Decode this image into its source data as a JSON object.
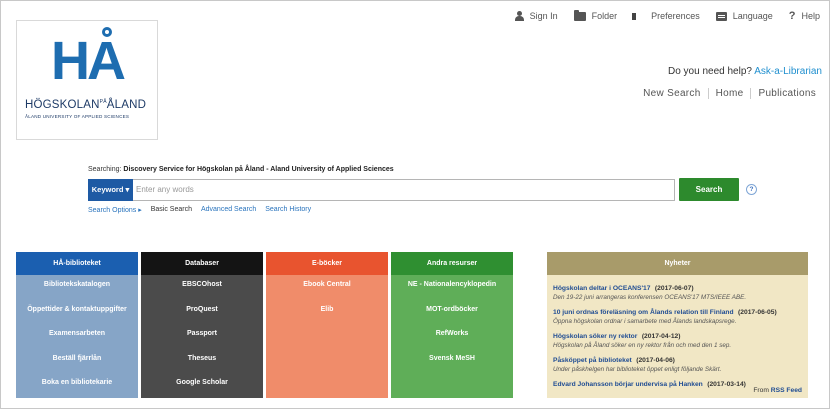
{
  "toolbar": {
    "sign_in": "Sign In",
    "folder": "Folder",
    "preferences": "Preferences",
    "language": "Language",
    "help": "Help",
    "help_glyph": "?"
  },
  "logo": {
    "mark": "HA",
    "name": "HÖGSKOLAN",
    "name_small": "PÅ",
    "name_end": "ÅLAND",
    "subtitle": "ÅLAND UNIVERSITY OF APPLIED SCIENCES"
  },
  "help_prompt": {
    "text": "Do you need help?",
    "link": "Ask-a-Librarian"
  },
  "nav": [
    "New Search",
    "Home",
    "Publications"
  ],
  "search": {
    "searching_label": "Searching:",
    "searching_source": "Discovery Service for Högskolan på Åland - Aland University of Applied Sciences",
    "mode": "Keyword ▾",
    "placeholder": "Enter any words",
    "button": "Search",
    "help_glyph": "?",
    "options": "Search Options ▸",
    "basic": "Basic Search",
    "advanced": "Advanced Search",
    "history": "Search History"
  },
  "panels": [
    {
      "title": "HÅ-biblioteket",
      "color": "#1b5fb0",
      "items": [
        "Bibliotekskatalogen",
        "Öppettider & kontaktuppgifter",
        "Examensarbeten",
        "Beställ fjärrlån",
        "Boka en bibliotekarie"
      ]
    },
    {
      "title": "Databaser",
      "color": "#141414",
      "items": [
        "EBSCOhost",
        "ProQuest",
        "Passport",
        "Theseus",
        "Google Scholar"
      ]
    },
    {
      "title": "E-böcker",
      "color": "#e8542f",
      "items": [
        "Ebook Central",
        "Elib"
      ]
    },
    {
      "title": "Andra resurser",
      "color": "#2f8f31",
      "items": [
        "NE - Nationalencyklopedin",
        "MOT-ordböcker",
        "RefWorks",
        "Svensk MeSH"
      ]
    }
  ],
  "news": {
    "title": "Nyheter",
    "items": [
      {
        "title": "Högskolan deltar i OCEANS'17",
        "date": "(2017-06-07)",
        "snippet": "Den 19-22 juni arrangeras konferensen OCEANS'17 MTS/IEEE ABE."
      },
      {
        "title": "10 juni ordnas föreläsning om Ålands relation till Finland",
        "date": "(2017-06-05)",
        "snippet": "Öppna högskolan ordnar i samarbete med Ålands landskapsrege."
      },
      {
        "title": "Högskolan söker ny rektor",
        "date": "(2017-04-12)",
        "snippet": "Högskolan på Åland söker en ny rektor från och med den 1 sep."
      },
      {
        "title": "Påsköppet på biblioteket",
        "date": "(2017-04-06)",
        "snippet": "Under påskhelgen har biblioteket öppet enligt följande Skärt."
      },
      {
        "title": "Edvard Johansson börjar undervisa på Hanken",
        "date": "(2017-03-14)",
        "snippet": ""
      }
    ],
    "rss_from": "From",
    "rss_link": "RSS Feed"
  }
}
